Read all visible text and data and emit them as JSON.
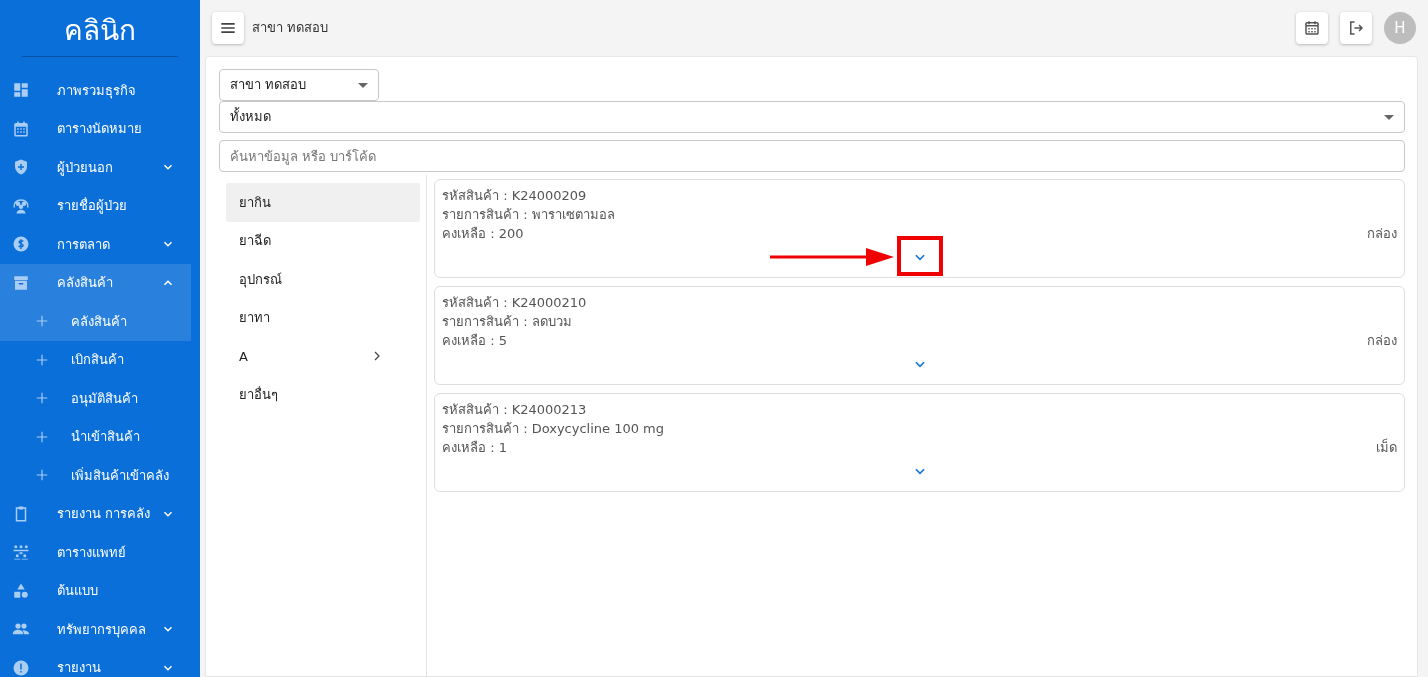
{
  "sidebar": {
    "title": "คลินิก",
    "items": [
      {
        "label": "ภาพรวมธุรกิจ"
      },
      {
        "label": "ตารางนัดหมาย"
      },
      {
        "label": "ผู้ป่วยนอก",
        "expanded": false
      },
      {
        "label": "รายชื่อผู้ป่วย"
      },
      {
        "label": "การตลาด",
        "expanded": false
      },
      {
        "label": "คลังสินค้า",
        "expanded": true,
        "children": [
          {
            "label": "คลังสินค้า",
            "selected": true
          },
          {
            "label": "เบิกสินค้า",
            "selected": false
          },
          {
            "label": "อนุมัติสินค้า",
            "selected": false
          },
          {
            "label": "นำเข้าสินค้า",
            "selected": false
          },
          {
            "label": "เพิ่มสินค้าเข้าคลัง",
            "selected": false
          }
        ]
      },
      {
        "label": "รายงาน การคลัง",
        "expanded": false
      },
      {
        "label": "ตารางแพทย์"
      },
      {
        "label": "ต้นแบบ"
      },
      {
        "label": "ทรัพยากรบุคคล",
        "expanded": false
      },
      {
        "label": "รายงาน",
        "expanded": false
      }
    ]
  },
  "topbar": {
    "branch": "สาขา ทดสอบ",
    "avatar": "H"
  },
  "filters": {
    "branch_select": "สาขา ทดสอบ",
    "type_select": "ทั้งหมด",
    "search": {
      "placeholder": "ค้นหาข้อมูล หรือ บาร์โค้ด"
    }
  },
  "categories": [
    {
      "label": "ยากิน",
      "selected": true,
      "submenu": false
    },
    {
      "label": "ยาฉีด",
      "selected": false,
      "submenu": false
    },
    {
      "label": "อุปกรณ์",
      "selected": false,
      "submenu": false
    },
    {
      "label": "ยาทา",
      "selected": false,
      "submenu": false
    },
    {
      "label": "A",
      "selected": false,
      "submenu": true
    },
    {
      "label": "ยาอื่นๆ",
      "selected": false,
      "submenu": false
    }
  ],
  "products": [
    {
      "code": "รหัสสินค้า : K24000209",
      "name": "รายการสินค้า : พาราเซตามอล",
      "remaining": "คงเหลือ : 200",
      "unit": "กล่อง",
      "highlighted": true
    },
    {
      "code": "รหัสสินค้า : K24000210",
      "name": "รายการสินค้า : ลดบวม",
      "remaining": "คงเหลือ : 5",
      "unit": "กล่อง",
      "highlighted": false
    },
    {
      "code": "รหัสสินค้า : K24000213",
      "name": "รายการสินค้า : Doxycycline 100 mg",
      "remaining": "คงเหลือ : 1",
      "unit": "เม็ด",
      "highlighted": false
    }
  ]
}
